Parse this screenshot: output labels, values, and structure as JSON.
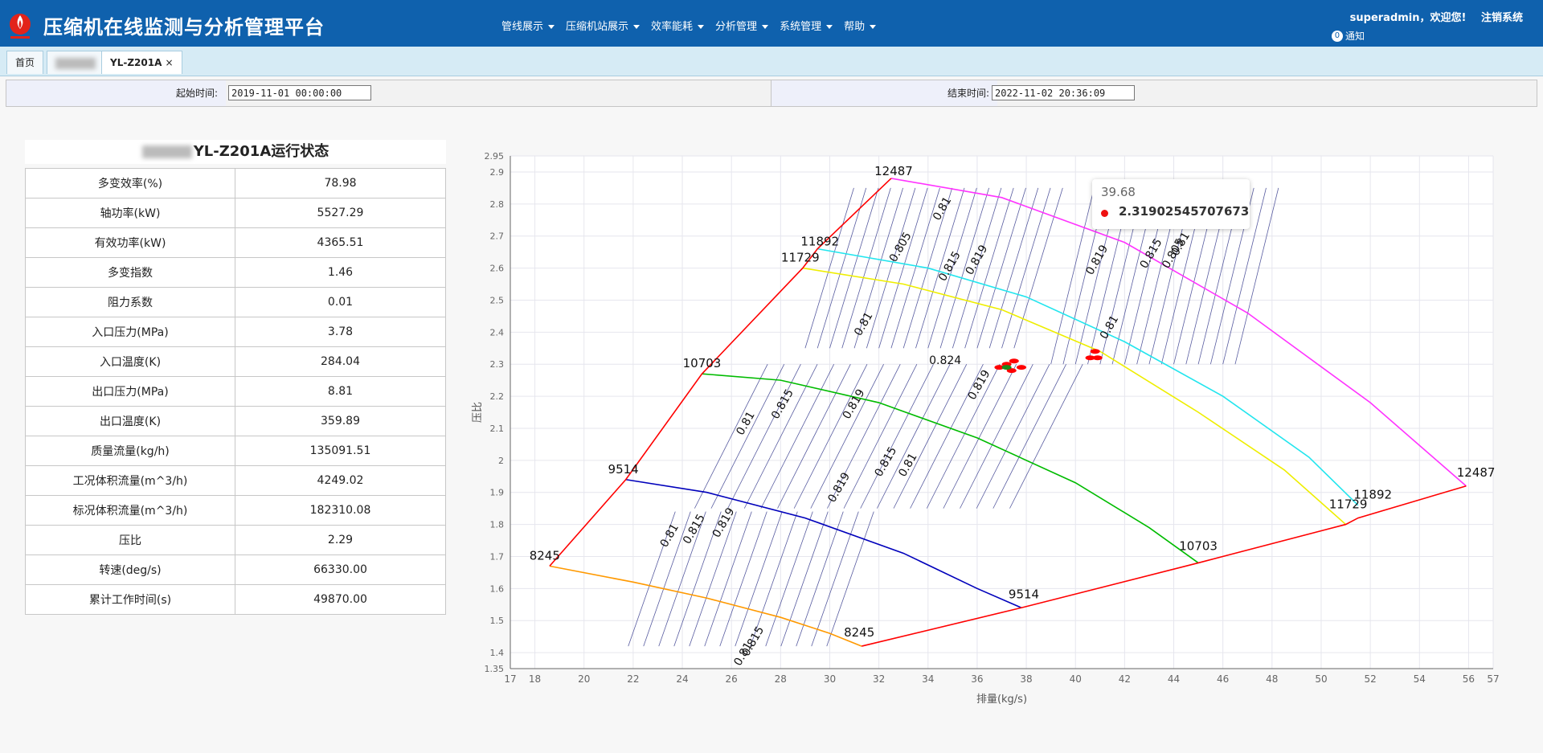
{
  "header": {
    "title": "压缩机在线监测与分析管理平台",
    "nav": [
      "管线展示",
      "压缩机站展示",
      "效率能耗",
      "分析管理",
      "系统管理",
      "帮助"
    ],
    "user_text": "superadmin，欢迎您!",
    "logout_label": "注销系统",
    "notice_count": "0",
    "notice_label": "通知"
  },
  "tabs": {
    "home": "首页",
    "active": "YL-Z201A",
    "close": "×"
  },
  "filter": {
    "start_label": "起始时间:",
    "start_value": "2019-11-01 00:00:00",
    "end_label": "结束时间:",
    "end_value": "2022-11-02 20:36:09"
  },
  "status": {
    "title": "YL-Z201A运行状态",
    "rows": [
      {
        "k": "多变效率(%)",
        "v": "78.98"
      },
      {
        "k": "轴功率(kW)",
        "v": "5527.29"
      },
      {
        "k": "有效功率(kW)",
        "v": "4365.51"
      },
      {
        "k": "多变指数",
        "v": "1.46"
      },
      {
        "k": "阻力系数",
        "v": "0.01"
      },
      {
        "k": "入口压力(MPa)",
        "v": "3.78"
      },
      {
        "k": "入口温度(K)",
        "v": "284.04"
      },
      {
        "k": "出口压力(MPa)",
        "v": "8.81"
      },
      {
        "k": "出口温度(K)",
        "v": "359.89"
      },
      {
        "k": "质量流量(kg/h)",
        "v": "135091.51"
      },
      {
        "k": "工况体积流量(m^3/h)",
        "v": "4249.02"
      },
      {
        "k": "标况体积流量(m^3/h)",
        "v": "182310.08"
      },
      {
        "k": "压比",
        "v": "2.29"
      },
      {
        "k": "转速(deg/s)",
        "v": "66330.00"
      },
      {
        "k": "累计工作时间(s)",
        "v": "49870.00"
      }
    ]
  },
  "tooltip": {
    "x": "39.68",
    "value": "2.31902545707673"
  },
  "chart_data": {
    "type": "line",
    "xlabel": "排量(kg/s)",
    "ylabel": "压比",
    "xlim": [
      17,
      57
    ],
    "ylim": [
      1.35,
      2.95
    ],
    "xticks": [
      17,
      18,
      20,
      22,
      24,
      26,
      28,
      30,
      32,
      34,
      36,
      38,
      40,
      42,
      44,
      46,
      48,
      50,
      52,
      54,
      56,
      57
    ],
    "yticks": [
      1.35,
      1.4,
      1.5,
      1.6,
      1.7,
      1.8,
      1.9,
      2.0,
      2.1,
      2.2,
      2.3,
      2.4,
      2.5,
      2.6,
      2.7,
      2.8,
      2.9,
      2.95
    ],
    "ytick_labels": [
      "1.35",
      "1.4",
      "1.5",
      "1.6",
      "1.7",
      "1.8",
      "1.9",
      "2",
      "2.1",
      "2.2",
      "2.3",
      "2.4",
      "2.5",
      "2.6",
      "2.7",
      "2.8",
      "2.9",
      "2.95"
    ],
    "grid": true,
    "surge_line": {
      "color": "#ff0000",
      "x": [
        18.6,
        21.7,
        24.8,
        28.9,
        29.5,
        32.5
      ],
      "y": [
        1.67,
        1.94,
        2.27,
        2.6,
        2.66,
        2.88
      ]
    },
    "choke_line": {
      "color": "#ff0000",
      "x": [
        31.3,
        37.8,
        45.0,
        51.0,
        51.5,
        55.9
      ],
      "y": [
        1.42,
        1.54,
        1.68,
        1.8,
        1.82,
        1.92
      ]
    },
    "speed_lines": [
      {
        "label": "12487",
        "color": "#ff33ff",
        "x": [
          32.5,
          37.0,
          42.0,
          47.0,
          52.0,
          55.9
        ],
        "y": [
          2.88,
          2.82,
          2.68,
          2.46,
          2.18,
          1.92
        ]
      },
      {
        "label": "11892",
        "color": "#22e5ee",
        "x": [
          29.5,
          34.0,
          38.0,
          42.0,
          46.0,
          49.5,
          51.5
        ],
        "y": [
          2.66,
          2.6,
          2.51,
          2.37,
          2.2,
          2.01,
          1.86
        ]
      },
      {
        "label": "11729",
        "color": "#eeee00",
        "x": [
          28.9,
          33.0,
          37.0,
          41.0,
          45.0,
          48.5,
          51.0
        ],
        "y": [
          2.6,
          2.55,
          2.47,
          2.34,
          2.15,
          1.97,
          1.8
        ]
      },
      {
        "label": "10703",
        "color": "#00bb00",
        "x": [
          24.8,
          28.0,
          32.0,
          36.0,
          40.0,
          43.0,
          45.0
        ],
        "y": [
          2.27,
          2.25,
          2.18,
          2.07,
          1.93,
          1.79,
          1.68
        ]
      },
      {
        "label": "9514",
        "color": "#0000bb",
        "x": [
          21.7,
          25.0,
          29.0,
          33.0,
          36.0,
          37.8
        ],
        "y": [
          1.94,
          1.9,
          1.82,
          1.71,
          1.6,
          1.54
        ]
      },
      {
        "label": "8245",
        "color": "#ff9900",
        "x": [
          18.6,
          22.0,
          25.0,
          28.0,
          30.0,
          31.3
        ],
        "y": [
          1.67,
          1.62,
          1.57,
          1.51,
          1.46,
          1.42
        ]
      }
    ],
    "end_labels": [
      {
        "text": "12487",
        "x": 32.6,
        "y": 2.89
      },
      {
        "text": "11892",
        "x": 29.6,
        "y": 2.67
      },
      {
        "text": "11729",
        "x": 28.8,
        "y": 2.62
      },
      {
        "text": "10703",
        "x": 24.8,
        "y": 2.29
      },
      {
        "text": "9514",
        "x": 21.6,
        "y": 1.96
      },
      {
        "text": "8245",
        "x": 18.4,
        "y": 1.69
      },
      {
        "text": "12487",
        "x": 56.3,
        "y": 1.95
      },
      {
        "text": "11892",
        "x": 52.1,
        "y": 1.88
      },
      {
        "text": "11729",
        "x": 51.1,
        "y": 1.85
      },
      {
        "text": "10703",
        "x": 45.0,
        "y": 1.72
      },
      {
        "text": "9514",
        "x": 37.9,
        "y": 1.57
      },
      {
        "text": "8245",
        "x": 31.2,
        "y": 1.45
      }
    ],
    "contour_labels": [
      {
        "text": "0.81",
        "x": 34.7,
        "y": 2.78
      },
      {
        "text": "0.805",
        "x": 33.0,
        "y": 2.66
      },
      {
        "text": "0.815",
        "x": 35.0,
        "y": 2.6
      },
      {
        "text": "0.819",
        "x": 36.1,
        "y": 2.62
      },
      {
        "text": "0.819",
        "x": 41.0,
        "y": 2.62
      },
      {
        "text": "0.815",
        "x": 43.2,
        "y": 2.64
      },
      {
        "text": "0.81",
        "x": 44.4,
        "y": 2.67
      },
      {
        "text": "0.805",
        "x": 44.1,
        "y": 2.64
      },
      {
        "text": "0.81",
        "x": 31.5,
        "y": 2.42
      },
      {
        "text": "0.81",
        "x": 41.5,
        "y": 2.41
      },
      {
        "text": "0.824",
        "x": 34.7,
        "y": 2.3
      },
      {
        "text": "0.819",
        "x": 36.2,
        "y": 2.23
      },
      {
        "text": "0.819",
        "x": 31.1,
        "y": 2.17
      },
      {
        "text": "0.815",
        "x": 28.2,
        "y": 2.17
      },
      {
        "text": "0.81",
        "x": 26.7,
        "y": 2.11
      },
      {
        "text": "0.815",
        "x": 32.4,
        "y": 1.99
      },
      {
        "text": "0.81",
        "x": 33.3,
        "y": 1.98
      },
      {
        "text": "0.819",
        "x": 30.5,
        "y": 1.91
      },
      {
        "text": "0.81",
        "x": 23.6,
        "y": 1.76
      },
      {
        "text": "0.815",
        "x": 24.6,
        "y": 1.78
      },
      {
        "text": "0.819",
        "x": 25.8,
        "y": 1.8
      },
      {
        "text": "0.815",
        "x": 27.0,
        "y": 1.43
      },
      {
        "text": "0.81",
        "x": 26.6,
        "y": 1.39
      }
    ],
    "operating_points": [
      {
        "x": 37.2,
        "y": 2.3,
        "color": "#ff0000"
      },
      {
        "x": 37.5,
        "y": 2.31,
        "color": "#ff0000"
      },
      {
        "x": 37.8,
        "y": 2.29,
        "color": "#ff0000"
      },
      {
        "x": 36.9,
        "y": 2.29,
        "color": "#ff0000"
      },
      {
        "x": 37.4,
        "y": 2.28,
        "color": "#ff0000"
      },
      {
        "x": 37.2,
        "y": 2.29,
        "color": "#1a8a1a"
      },
      {
        "x": 40.6,
        "y": 2.32,
        "color": "#ff0000"
      },
      {
        "x": 40.9,
        "y": 2.32,
        "color": "#ff0000"
      },
      {
        "x": 40.8,
        "y": 2.34,
        "color": "#ff0000"
      }
    ]
  }
}
